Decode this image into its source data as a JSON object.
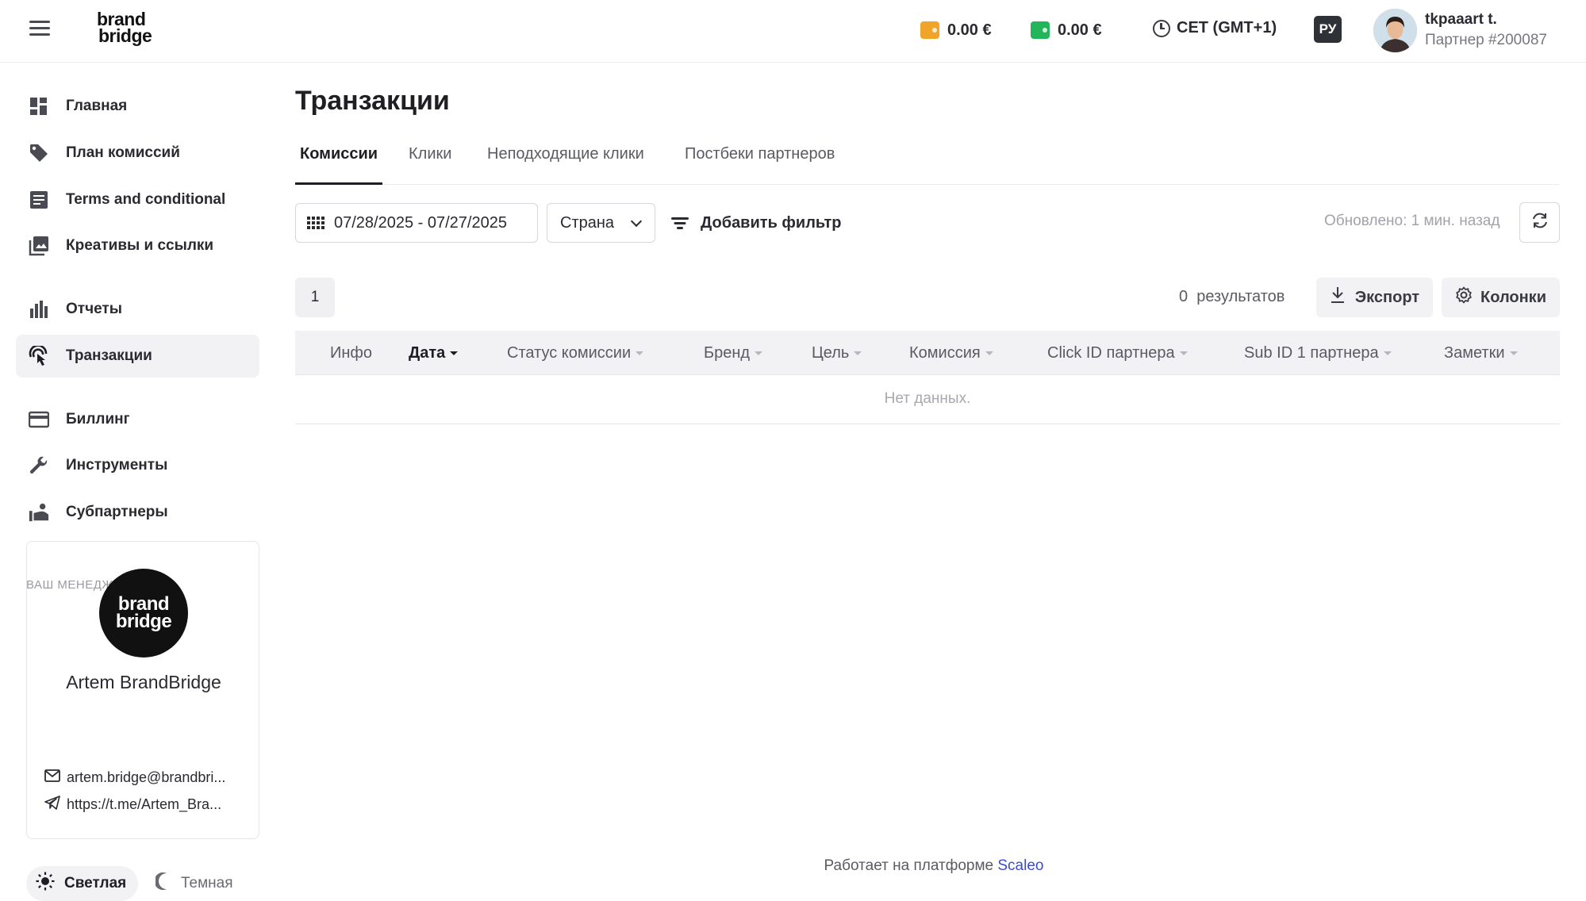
{
  "header": {
    "logo_line1": "brand",
    "logo_line2": "bridge",
    "balance_1": "0.00 €",
    "balance_2": "0.00 €",
    "timezone": "CET (GMT+1)",
    "language": "РУ",
    "user_name": "tkpaaart t.",
    "user_sub": "Партнер #200087",
    "colors": {
      "wallet_1": "#f0a52a",
      "wallet_2": "#22b55a"
    }
  },
  "sidebar": {
    "items": [
      {
        "label": "Главная",
        "icon": "dashboard-icon"
      },
      {
        "label": "План комиссий",
        "icon": "tag-icon"
      },
      {
        "label": "Terms and conditional",
        "icon": "document-icon"
      },
      {
        "label": "Креативы и ссылки",
        "icon": "image-gallery-icon"
      },
      {
        "label": "Отчеты",
        "icon": "bar-chart-icon"
      },
      {
        "label": "Транзакции",
        "icon": "touch-icon",
        "active": true
      },
      {
        "label": "Биллинг",
        "icon": "credit-card-icon"
      },
      {
        "label": "Инструменты",
        "icon": "wrench-icon"
      },
      {
        "label": "Субпартнеры",
        "icon": "subpartners-icon"
      }
    ],
    "manager": {
      "title": "ВАШ МЕНЕДЖЕР",
      "logo_line1": "brand",
      "logo_line2": "bridge",
      "name": "Artem BrandBridge",
      "email": "artem.bridge@brandbri...",
      "telegram": "https://t.me/Artem_Bra..."
    },
    "theme": {
      "light": "Светлая",
      "dark": "Темная"
    }
  },
  "main": {
    "title": "Транзакции",
    "tabs": [
      {
        "label": "Комиссии",
        "active": true
      },
      {
        "label": "Клики"
      },
      {
        "label": "Неподходящие клики"
      },
      {
        "label": "Постбеки партнеров"
      }
    ],
    "filters": {
      "date_range": "07/28/2025 - 07/27/2025",
      "country": "Страна",
      "add_filter": "Добавить фильтр",
      "updated": "Обновлено: 1 мин. назад"
    },
    "pagination": {
      "page": "1"
    },
    "results": {
      "count": "0",
      "label": "результатов"
    },
    "export_label": "Экспорт",
    "columns_label": "Колонки",
    "table": {
      "columns": [
        "Инфо",
        "Дата",
        "Статус комиссии",
        "Бренд",
        "Цель",
        "Комиссия",
        "Click ID партнера",
        "Sub ID 1 партнера",
        "Заметки"
      ],
      "sorted_column": "Дата",
      "empty": "Нет данных."
    }
  },
  "footer": {
    "text": "Работает на платформе",
    "link": "Scaleo"
  }
}
